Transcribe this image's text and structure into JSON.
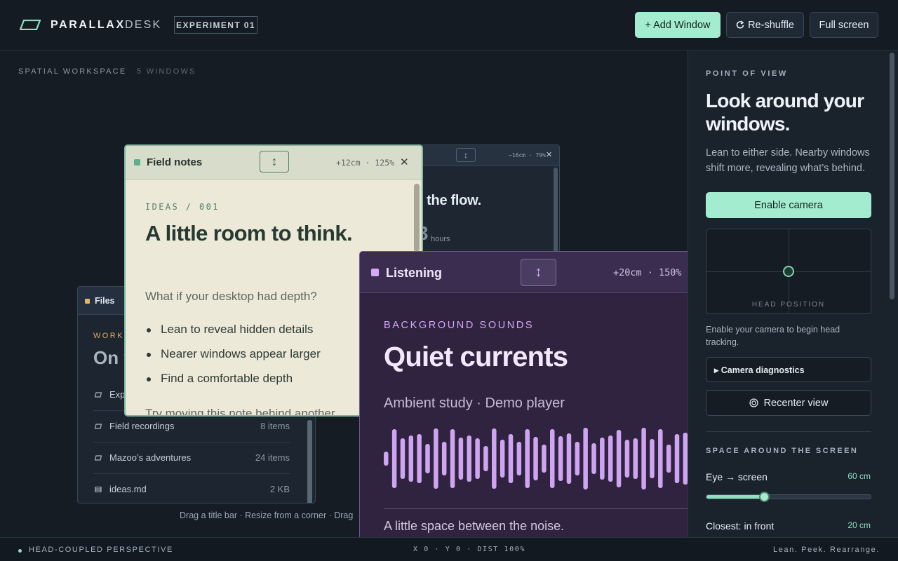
{
  "header": {
    "brand": "PARALLAX",
    "brand_sub": "DESK",
    "badge": "EXPERIMENT 01",
    "add_window_label": "+ Add Window",
    "reshuffle_label": "Re-shuffle",
    "reshuffle_icon": "refresh-icon",
    "fullscreen_label": "Full screen"
  },
  "workspace": {
    "label": "SPATIAL WORKSPACE",
    "count": "5 WINDOWS",
    "hint": "Drag a title bar · Resize from a corner · Drag"
  },
  "windows": {
    "back_dark": {
      "meta": "−16cm · 79%",
      "heading": "g the flow.",
      "number": "3",
      "unit": "hours"
    },
    "files": {
      "title": "Files",
      "accent": "#e7b36a",
      "eyebrow": "WORKS",
      "heading": "On t",
      "rows": [
        {
          "name": "Exp",
          "meta": "",
          "icon": "folder-icon"
        },
        {
          "name": "Field recordings",
          "meta": "8 items",
          "icon": "folder-icon"
        },
        {
          "name": "Mazoo’s adventures",
          "meta": "24 items",
          "icon": "folder-icon"
        },
        {
          "name": "ideas.md",
          "meta": "2 KB",
          "icon": "file-icon"
        }
      ]
    },
    "notes": {
      "title": "Field notes",
      "accent": "#5fae8d",
      "meta": "+12cm · 125%",
      "eyebrow": "IDEAS / 001",
      "heading": "A little room to think.",
      "lede": "What if your desktop had depth?",
      "bullets": [
        "Lean to reveal hidden details",
        "Nearer windows appear larger",
        "Find a comfortable depth"
      ],
      "tail": "Try moving this note behind another"
    },
    "listening": {
      "title": "Listening",
      "accent": "#d6a7f5",
      "meta": "+20cm · 150%",
      "eyebrow": "BACKGROUND SOUNDS",
      "heading": "Quiet currents",
      "subtitle": "Ambient study · Demo player",
      "tail": "A little space between the noise."
    }
  },
  "panel": {
    "eyebrow": "POINT OF VIEW",
    "heading": "Look around your windows.",
    "description": "Lean to either side. Nearby windows shift more, revealing what’s behind.",
    "enable_label": "Enable camera",
    "pad_label": "HEAD POSITION",
    "status": "Enable your camera to begin head tracking.",
    "diagnostics_label": "▸ Camera diagnostics",
    "recenter_label": "Recenter view",
    "section_title": "SPACE AROUND THE SCREEN",
    "eye_label": "Eye → screen",
    "eye_value": "60 cm",
    "eye_fraction": 0.35,
    "closest_label": "Closest: in front",
    "closest_value": "20 cm"
  },
  "footer": {
    "left": "HEAD-COUPLED PERSPECTIVE",
    "middle": "X 0 · Y 0 · DIST 100%",
    "right": "Lean. Peek. Rearrange."
  },
  "colors": {
    "accent": "#a3ecd0",
    "background": "#151c24"
  }
}
